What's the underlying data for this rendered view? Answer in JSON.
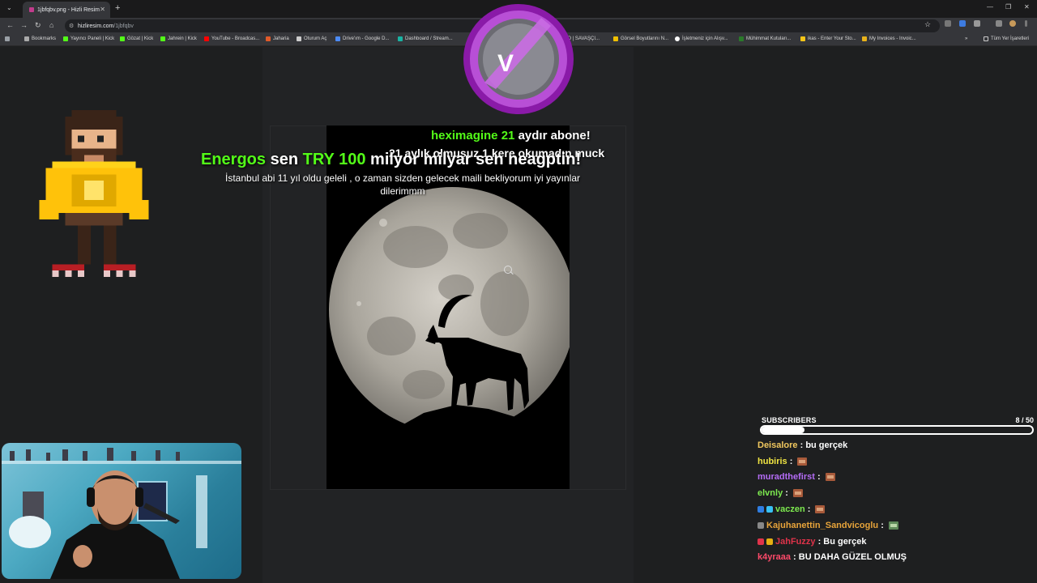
{
  "browser": {
    "tab_title": "1jbfqbv.png - Hizli Resim",
    "tab_close": "✕",
    "new_tab": "+",
    "url_host": "hizliresim.com",
    "url_path": "/1jbfqbv",
    "window_min": "—",
    "window_max": "❐",
    "window_close": "✕",
    "bookmarks": [
      "Bookmarks",
      "Yayıncı Paneli | Kick",
      "Gözat | Kick",
      "Jahrein | Kick",
      "YouTube - Broadcas...",
      "Jaharia",
      "Oturum Aç",
      "Drive'ım - Google D...",
      "Dashboard / Stream...",
      "DO | SAVAŞÇI...",
      "Görsel Boyutlarını N...",
      "İşletmeniz için Alışv...",
      "Mühimmat Kutuları...",
      "ikas - Enter Your Sto...",
      "My Invoices - Invoic...",
      "Tüm Yer İşaretleri"
    ],
    "bookmark_more": "»"
  },
  "overlay": {
    "logo_letter": "V",
    "sub_alert": {
      "username": "heximagine",
      "months": "21",
      "text": "aydır abone!",
      "message": "21 aylık olmuşuz 1 kere okumadın muck"
    },
    "tip_alert": {
      "username": "Energos",
      "word_sen": "sen",
      "currency": "TRY",
      "amount": "100",
      "text": "milyor milyar sen neagptin!",
      "message": "İstanbul abi 11 yıl oldu geleli , o zaman sizden gelecek maili bekliyorum iyi yayınlar dilerimmm"
    },
    "subscribers": {
      "label": "SUBSCRIBERS",
      "count": "8 / 50",
      "progress": 0.16
    },
    "chat": [
      {
        "user": "Deisalore",
        "color": "#f0c75e",
        "message": "bu gerçek",
        "emote": "",
        "badges": []
      },
      {
        "user": "hubiris",
        "color": "#f0e442",
        "message": "",
        "emote": "brick",
        "badges": []
      },
      {
        "user": "muradthefirst",
        "color": "#b46cf5",
        "message": "",
        "emote": "brick",
        "badges": []
      },
      {
        "user": "elvnly",
        "color": "#7dea4f",
        "message": "",
        "emote": "brick",
        "badges": []
      },
      {
        "user": "vaczen",
        "color": "#7dea4f",
        "message": "",
        "emote": "brick",
        "badges": [
          "#2f7de1",
          "#39c1f5"
        ]
      },
      {
        "user": "Kajuhanettin_Sandvicoglu",
        "color": "#e8a43a",
        "message": "",
        "emote": "green",
        "badges": [
          "#888888"
        ]
      },
      {
        "user": "JahFuzzy",
        "color": "#e0334a",
        "message": "Bu gerçek",
        "emote": "",
        "badges": [
          "#e0334a",
          "#e6b012"
        ]
      },
      {
        "user": "k4yraaa",
        "color": "#ff4a6a",
        "message": "BU DAHA GÜZEL OLMUŞ",
        "emote": "",
        "badges": []
      }
    ]
  }
}
